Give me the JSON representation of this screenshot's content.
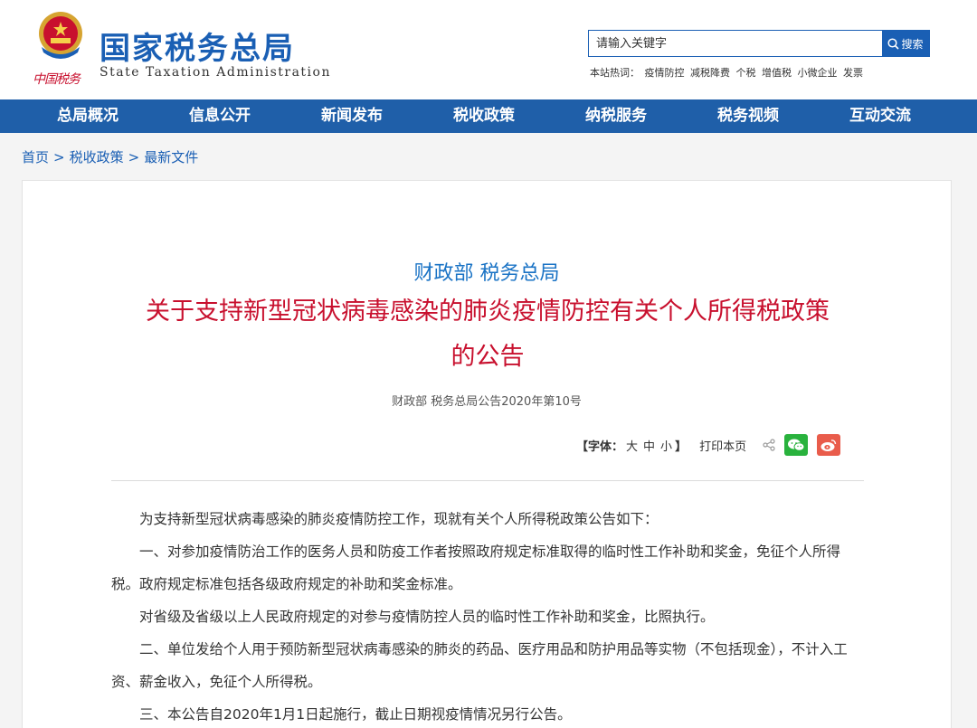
{
  "header": {
    "site_name": "国家税务总局",
    "site_name_en": "State Taxation Administration",
    "logo_subtext": "中国税务",
    "search": {
      "placeholder": "请输入关键字",
      "button_label": "搜索"
    },
    "hot": {
      "label": "本站热词：",
      "words": [
        "疫情防控",
        "减税降费",
        "个税",
        "增值税",
        "小微企业",
        "发票"
      ]
    }
  },
  "nav": {
    "items": [
      "总局概况",
      "信息公开",
      "新闻发布",
      "税收政策",
      "纳税服务",
      "税务视频",
      "互动交流"
    ]
  },
  "breadcrumb": {
    "home": "首页",
    "sep": ">",
    "level1": "税收政策",
    "level2": "最新文件"
  },
  "article": {
    "issuer": "财政部 税务总局",
    "title": "关于支持新型冠状病毒感染的肺炎疫情防控有关个人所得税政策的公告",
    "doc_number": "财政部 税务总局公告2020年第10号",
    "tools": {
      "font_label": "【字体：",
      "font_large": "大",
      "font_medium": "中",
      "font_small": "小",
      "font_close": "】",
      "print": "打印本页"
    },
    "paragraphs": [
      "为支持新型冠状病毒感染的肺炎疫情防控工作，现就有关个人所得税政策公告如下：",
      "一、对参加疫情防治工作的医务人员和防疫工作者按照政府规定标准取得的临时性工作补助和奖金，免征个人所得税。政府规定标准包括各级政府规定的补助和奖金标准。",
      "对省级及省级以上人民政府规定的对参与疫情防控人员的临时性工作补助和奖金，比照执行。",
      "二、单位发给个人用于预防新型冠状病毒感染的肺炎的药品、医疗用品和防护用品等实物（不包括现金），不计入工资、薪金收入，免征个人所得税。",
      "三、本公告自2020年1月1日起施行，截止日期视疫情情况另行公告。"
    ]
  },
  "colors": {
    "brand_blue": "#1a5fb4",
    "nav_blue": "#1f5fa9",
    "title_red": "#c8102e",
    "issuer_blue": "#1a73c5",
    "wechat_green": "#29b23d",
    "weibo_red": "#e95c4b"
  }
}
